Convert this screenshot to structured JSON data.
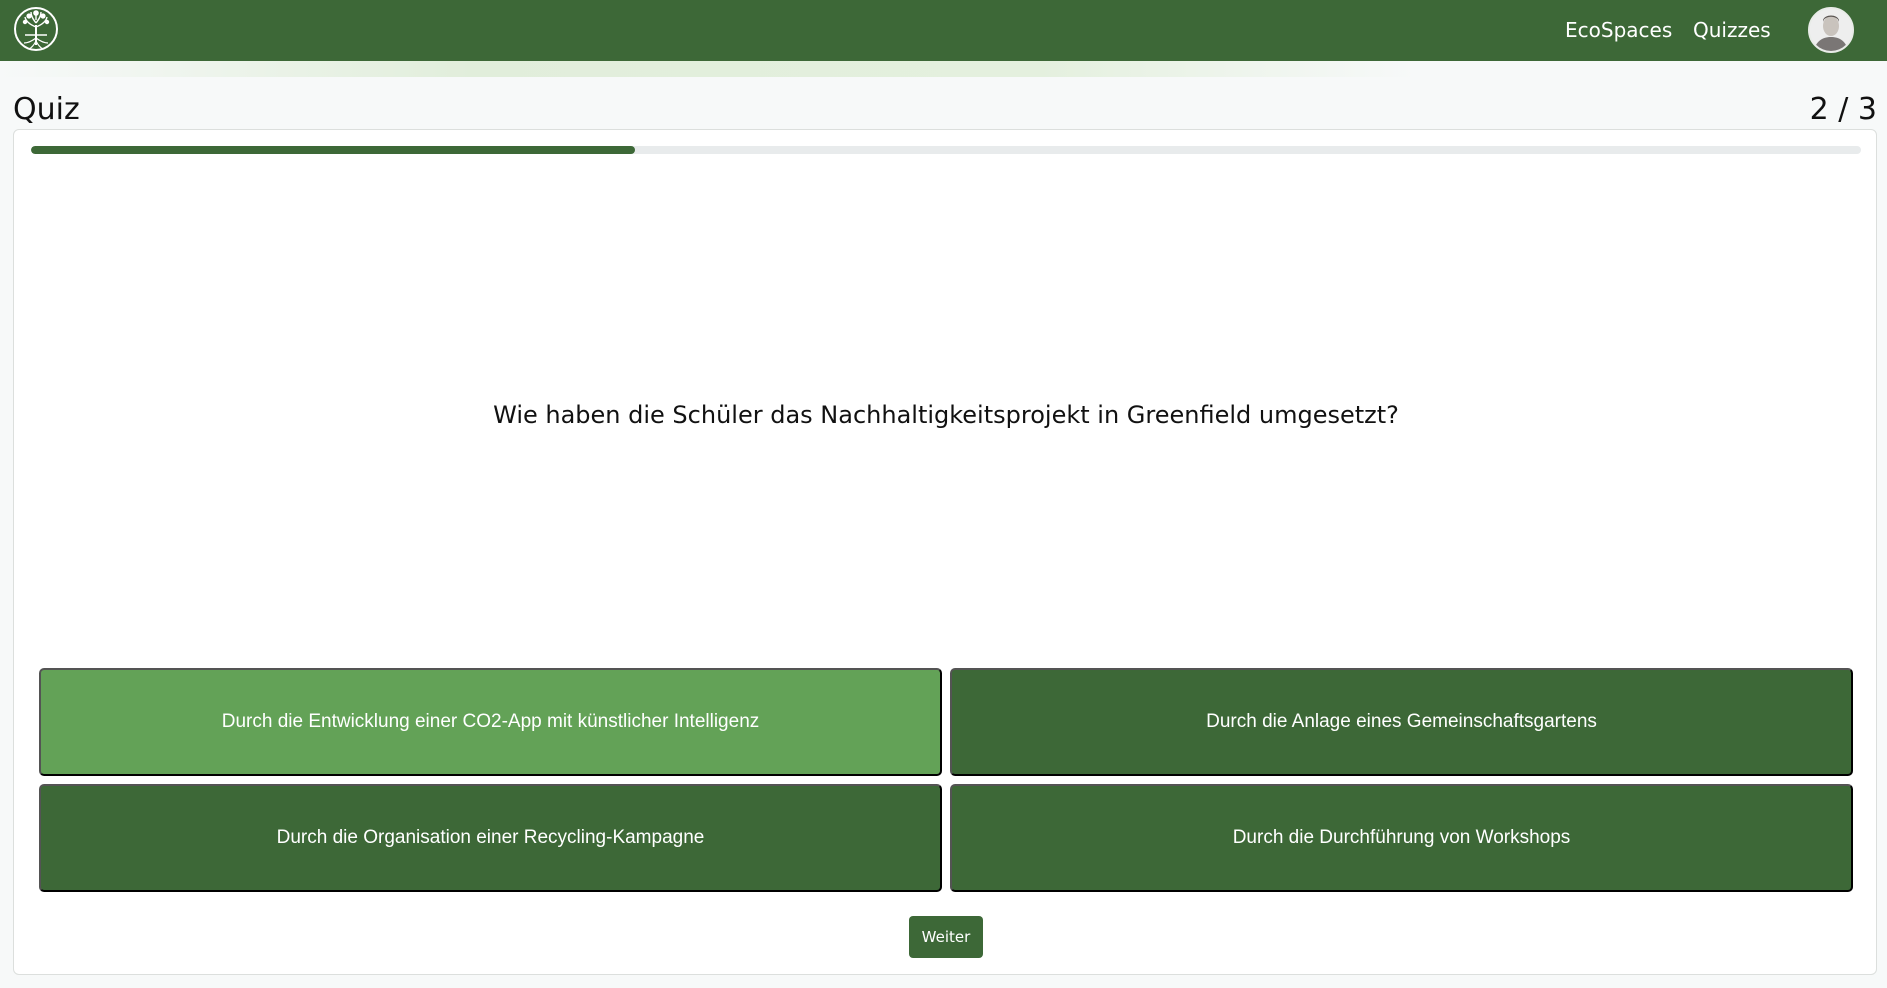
{
  "navbar": {
    "logo_icon": "tree-roots-logo-icon",
    "links": [
      "EcoSpaces",
      "Quizzes"
    ],
    "avatar_icon": "user-avatar-icon",
    "color": "#3d6837"
  },
  "quiz": {
    "title": "Quiz",
    "counter": "2 / 3",
    "progress": 0.33,
    "question": "Wie haben die Schüler das Nachhaltigkeitsprojekt in Greenfield umgesetzt?",
    "answers": [
      "Durch die Entwicklung einer CO2-App mit künstlicher Intelligenz",
      "Durch die Anlage eines Gemeinschaftsgartens",
      "Durch die Organisation einer Recycling-Kampagne",
      "Durch die Durchführung von Workshops"
    ],
    "selected_answer_index": 0,
    "next_label": "Weiter"
  },
  "colors": {
    "primary": "#3d6837",
    "selected": "#63a257"
  }
}
